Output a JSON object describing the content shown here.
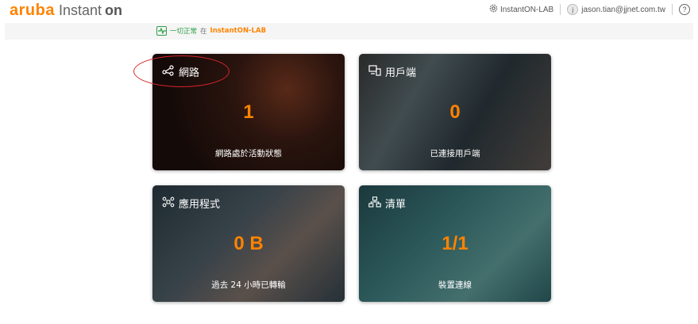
{
  "header": {
    "brand_primary": "aruba",
    "brand_secondary": "Instant",
    "brand_on": "on",
    "site_name": "InstantON-LAB",
    "user_initial": "j",
    "user_email": "jason.tian@jjnet.com.tw",
    "help_label": "?"
  },
  "status": {
    "ok_text": "一切正常",
    "in_text": "在",
    "site_text": "InstantON-LAB"
  },
  "tiles": [
    {
      "title": "網路",
      "value": "1",
      "label": "網路處於活動狀態",
      "icon": "share-icon"
    },
    {
      "title": "用戶端",
      "value": "0",
      "label": "已連接用戶端",
      "icon": "devices-icon"
    },
    {
      "title": "應用程式",
      "value": "0 B",
      "label": "過去 24 小時已轉輸",
      "icon": "apps-icon"
    },
    {
      "title": "清單",
      "value": "1/1",
      "label": "裝置連線",
      "icon": "inventory-icon"
    }
  ],
  "colors": {
    "accent": "#ff8300",
    "ok_green": "#2f9e49",
    "highlight_ring": "#d9252a"
  }
}
